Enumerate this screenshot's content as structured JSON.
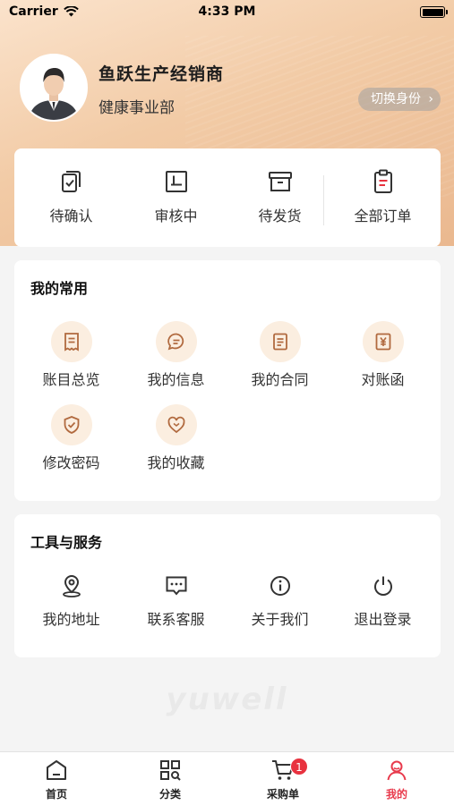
{
  "status_bar": {
    "carrier": "Carrier",
    "time": "4:33 PM"
  },
  "profile": {
    "name": "鱼跃生产经销商",
    "department": "健康事业部",
    "switch_label": "切换身份"
  },
  "orders": [
    {
      "label": "待确认",
      "icon": "order-confirm-icon"
    },
    {
      "label": "审核中",
      "icon": "order-review-icon"
    },
    {
      "label": "待发货",
      "icon": "order-ship-icon"
    },
    {
      "label": "全部订单",
      "icon": "order-all-icon"
    }
  ],
  "common": {
    "title": "我的常用",
    "items": [
      {
        "label": "账目总览",
        "icon": "receipt-icon"
      },
      {
        "label": "我的信息",
        "icon": "message-icon"
      },
      {
        "label": "我的合同",
        "icon": "contract-icon"
      },
      {
        "label": "对账函",
        "icon": "yen-icon"
      },
      {
        "label": "修改密码",
        "icon": "shield-check-icon"
      },
      {
        "label": "我的收藏",
        "icon": "heart-icon"
      }
    ]
  },
  "tools": {
    "title": "工具与服务",
    "items": [
      {
        "label": "我的地址",
        "icon": "location-icon"
      },
      {
        "label": "联系客服",
        "icon": "chat-icon"
      },
      {
        "label": "关于我们",
        "icon": "info-icon"
      },
      {
        "label": "退出登录",
        "icon": "power-icon"
      }
    ]
  },
  "tabbar": {
    "active_tab": "我的",
    "accent_color": "#e83a4c",
    "tabs": [
      {
        "label": "首页",
        "icon": "home-icon"
      },
      {
        "label": "分类",
        "icon": "category-icon"
      },
      {
        "label": "采购单",
        "icon": "cart-icon",
        "badge": "1"
      },
      {
        "label": "我的",
        "icon": "profile-icon"
      }
    ]
  }
}
